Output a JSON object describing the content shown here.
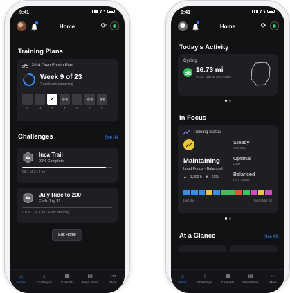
{
  "left": {
    "status_time": "9:41",
    "header_title": "Home",
    "training_plans": {
      "title": "Training Plans",
      "plan_name": "2024 Gran Fondo Plan",
      "week": "Week 9 of 23",
      "workouts_remaining": "2 workouts remaining",
      "progress": 0.75,
      "days": [
        {
          "label": "S",
          "mark": ""
        },
        {
          "label": "M",
          "mark": ""
        },
        {
          "label": "T",
          "mark": "✓"
        },
        {
          "label": "T",
          "mark": "bike"
        },
        {
          "label": "F",
          "mark": ""
        },
        {
          "label": "F",
          "mark": "bike"
        },
        {
          "label": "S",
          "mark": "bike"
        }
      ]
    },
    "challenges": {
      "title": "Challenges",
      "see_all": "See All",
      "items": [
        {
          "name": "Inca Trail",
          "sub": "93% Complete",
          "meta": "23.1 of 24.9 mi",
          "progress": 0.93
        },
        {
          "name": "July Ride to 200",
          "sub": "Ends July 31",
          "meta": "0.0 of 124.3 mi · Ends Monday",
          "progress": 0.0
        }
      ],
      "edit_home": "Edit Home"
    }
  },
  "right": {
    "status_time": "9:41",
    "header_title": "Home",
    "todays_activity": {
      "title": "Today's Activity",
      "type": "Cycling",
      "distance": "16.73 mi",
      "meta": "57:42 · 167 W Avg Power"
    },
    "in_focus": {
      "title": "In Focus",
      "card_title": "Training Status",
      "status": "Maintaining",
      "focus": "Load Focus - Balanced",
      "stat_hours": "3,200 h",
      "stat_pct": "62%",
      "kv": [
        {
          "value": "Steady",
          "key": "VO2 Max"
        },
        {
          "value": "Optimal",
          "key": "Load"
        },
        {
          "value": "Balanced",
          "key": "HRV Status"
        }
      ],
      "strip_colors": [
        "#3a8bea",
        "#3a8bea",
        "#3a8bea",
        "#e9c63a",
        "#3a8bea",
        "#3fbf5f",
        "#3fbf5f",
        "#e5542e",
        "#3fbf5f",
        "#d24bbd",
        "#e9c63a",
        "#d24bbd"
      ],
      "axis_left": "Last 4w",
      "axis_right": "Since Mar 24"
    },
    "at_a_glance": {
      "title": "At a Glance",
      "see_all": "See All"
    }
  },
  "tabs": [
    {
      "label": "Home",
      "icon": "home-icon"
    },
    {
      "label": "Challenges",
      "icon": "challenges-icon"
    },
    {
      "label": "Calendar",
      "icon": "calendar-icon"
    },
    {
      "label": "News Feed",
      "icon": "newsfeed-icon"
    },
    {
      "label": "More",
      "icon": "more-icon"
    }
  ]
}
